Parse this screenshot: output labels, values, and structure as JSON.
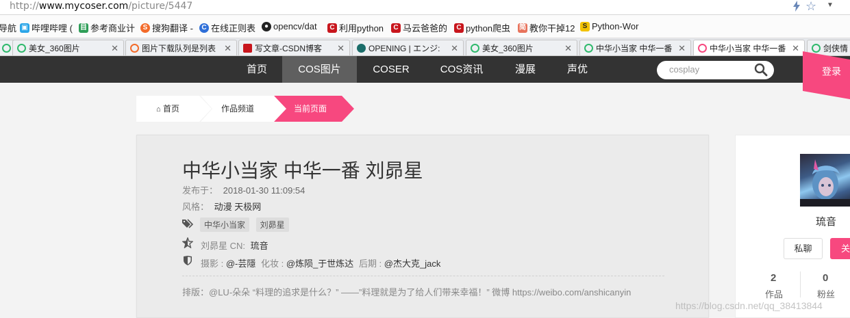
{
  "browser": {
    "url_prefix": "http://",
    "url_host": "www.mycoser.com",
    "url_path": "/picture/5447"
  },
  "bookmarks": [
    {
      "label": "导航",
      "icon": "navigation-icon"
    },
    {
      "label": "哔哩哔哩 (",
      "icon": "bilibili-icon"
    },
    {
      "label": "参考商业计",
      "icon": "document-icon"
    },
    {
      "label": "搜狗翻译 -",
      "icon": "sogou-icon"
    },
    {
      "label": "在线正则表",
      "icon": "regex-icon"
    },
    {
      "label": "opencv/dat",
      "icon": "github-icon"
    },
    {
      "label": "利用python",
      "icon": "csdn-icon"
    },
    {
      "label": "马云爸爸的",
      "icon": "csdn-icon"
    },
    {
      "label": "python爬虫",
      "icon": "csdn-icon"
    },
    {
      "label": "教你干掉12",
      "icon": "jianshu-icon"
    },
    {
      "label": "Python-Wor",
      "icon": "python-icon"
    }
  ],
  "tabs": [
    {
      "label": "美女_360图片"
    },
    {
      "label": "图片下载队列是列表"
    },
    {
      "label": "写文章-CSDN博客"
    },
    {
      "label": "OPENING | エンジ:"
    },
    {
      "label": "美女_360图片"
    },
    {
      "label": "中华小当家 中华一番"
    },
    {
      "label": "中华小当家 中华一番"
    },
    {
      "label": "剑侠情"
    }
  ],
  "nav": {
    "items": [
      "首页",
      "COS图片",
      "COSER",
      "COS资讯",
      "漫展",
      "声优"
    ],
    "search_value": "cosplay",
    "login": "登录"
  },
  "breadcrumb": {
    "home": "首页",
    "channel": "作品频道",
    "current": "当前页面"
  },
  "post": {
    "title": "中华小当家 中华一番 刘昴星",
    "published_label": "发布于：",
    "published_value": "2018-01-30 11:09:54",
    "style_label": "风格：",
    "style_value": "动漫 天极网",
    "tags": [
      "中华小当家",
      "刘昴星"
    ],
    "character": "刘昴星 CN:",
    "cn_name": "琉音",
    "photo_label": "摄影 :",
    "photo_value": "@-芸隱",
    "makeup_label": "化妆 :",
    "makeup_value": "@炼陨_于世炼达",
    "post_label": "后期 :",
    "post_value": "@杰大克_jack",
    "note": "排版：@LU-朵朵 “料理的追求是什么？” ——”料理就是为了给人们带来幸福！” 微博 https://weibo.com/anshicanyin"
  },
  "profile": {
    "name": "琉音",
    "pm": "私聊",
    "follow": "关",
    "works_count": "2",
    "works_label": "作品",
    "fans_count": "0",
    "fans_label": "粉丝"
  },
  "watermark": "https://blog.csdn.net/qq_38413844",
  "colors": {
    "accent": "#f7487f",
    "nav_bg": "#333333",
    "nav_active": "#5f5f5f"
  }
}
